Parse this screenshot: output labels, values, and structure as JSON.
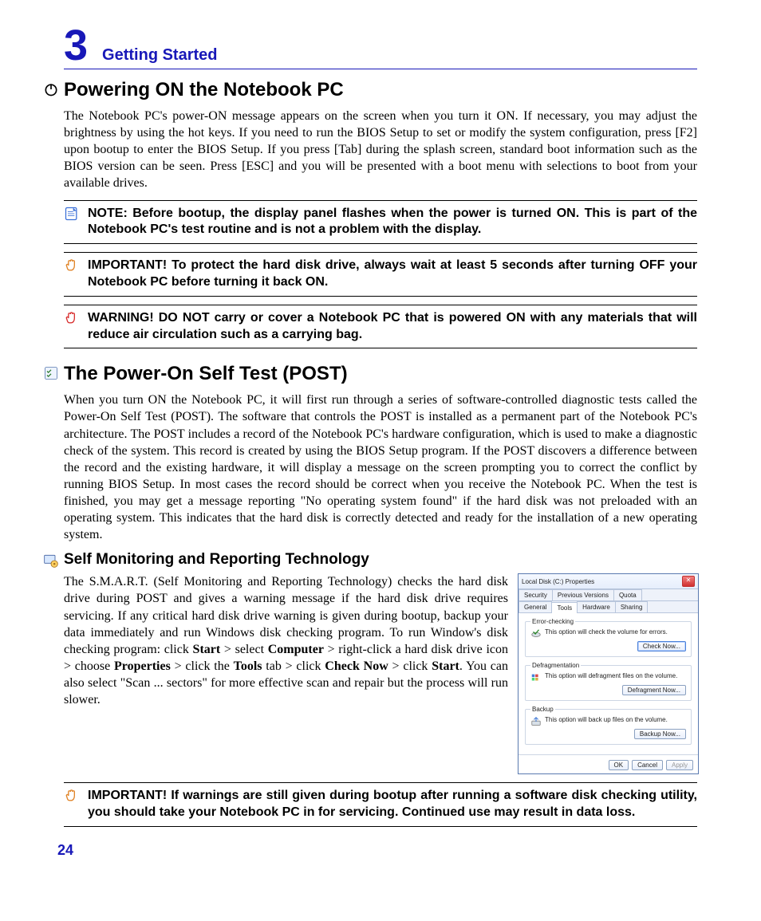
{
  "chapter": {
    "number": "3",
    "title": "Getting Started"
  },
  "page_number": "24",
  "section1": {
    "heading": "Powering ON the Notebook PC",
    "body": "The Notebook PC's power-ON message appears on the screen when you turn it ON. If necessary, you may adjust the brightness by using the hot keys. If you need to run the BIOS Setup to set or modify the system configuration, press [F2] upon bootup to enter the BIOS Setup. If you press [Tab] during the splash screen, standard boot information such as the BIOS version can be seen. Press [ESC] and you will be presented with a boot menu with selections to boot from your available drives."
  },
  "note1": {
    "text": "NOTE:  Before bootup, the display panel flashes when the power is turned ON. This is part of the Notebook PC's test routine and is not a problem with the display."
  },
  "important1": {
    "text": "IMPORTANT!  To protect the hard disk drive, always wait at least 5 seconds after turning OFF your Notebook PC before turning it back ON."
  },
  "warning1": {
    "text": "WARNING! DO NOT carry or cover a Notebook PC that is powered ON with any materials that will reduce air circulation such as a carrying bag."
  },
  "section2": {
    "heading": "The Power-On Self Test (POST)",
    "body": "When you turn ON the Notebook PC, it will first run through a series of software-controlled diagnostic tests called the Power-On Self Test (POST). The software that controls the POST is installed as a permanent part of the Notebook PC's architecture. The POST includes a record of the Notebook PC's hardware configuration, which is used to make a diagnostic check of the system. This record is created by using the BIOS Setup program. If the POST discovers a difference between the record and the existing hardware, it will display a message on the screen prompting you to correct the conflict by running BIOS Setup. In most cases the record should be correct when you receive the Notebook PC. When the test is finished, you may get a message reporting \"No operating system found\" if the hard disk was not preloaded with an operating system. This indicates that the hard disk is correctly detected and ready for the installation of a new operating system."
  },
  "section3": {
    "heading": "Self Monitoring and Reporting Technology",
    "body_parts": {
      "p1": "The S.M.A.R.T. (Self Monitoring and Reporting Technology) checks the hard disk drive during POST and gives a warning message if the hard disk drive requires servicing. If any critical hard disk drive warning is given during bootup, backup your data immediately and run Windows disk checking program. To run Window's disk checking program: click ",
      "b1": "Start",
      "s1": " > select ",
      "b2": "Computer",
      "s2": " > right-click a hard disk drive icon > choose ",
      "b3": "Properties",
      "s3": " > click the ",
      "b4": "Tools",
      "s4": " tab > click ",
      "b5": "Check Now",
      "s5": " > click ",
      "b6": "Start",
      "s6": ". You can also select \"Scan ... sectors\" for more effective scan and repair but the process will run slower."
    }
  },
  "important2": {
    "text": "IMPORTANT! If warnings are still given during bootup after running a software disk checking utility, you should take your Notebook PC in for servicing. Continued use may result in data loss."
  },
  "dialog": {
    "title": "Local Disk (C:) Properties",
    "tabs_row1": [
      "Security",
      "Previous Versions",
      "Quota"
    ],
    "tabs_row2": [
      "General",
      "Tools",
      "Hardware",
      "Sharing"
    ],
    "active_tab": "Tools",
    "groups": {
      "error_check": {
        "legend": "Error-checking",
        "text": "This option will check the volume for errors.",
        "button": "Check Now..."
      },
      "defrag": {
        "legend": "Defragmentation",
        "text": "This option will defragment files on the volume.",
        "button": "Defragment Now..."
      },
      "backup": {
        "legend": "Backup",
        "text": "This option will back up files on the volume.",
        "button": "Backup Now..."
      }
    },
    "footer": {
      "ok": "OK",
      "cancel": "Cancel",
      "apply": "Apply"
    }
  }
}
